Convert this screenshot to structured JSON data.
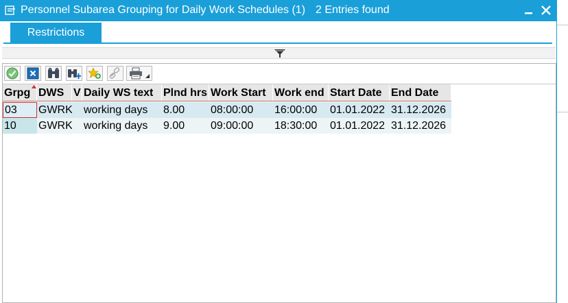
{
  "window": {
    "title": "Personnel Subarea Grouping for Daily Work Schedules (1)",
    "entries_found": "2 Entries found"
  },
  "tabs": [
    {
      "label": "Restrictions",
      "active": true
    }
  ],
  "toolbar": {
    "buttons": [
      {
        "name": "accept-button",
        "icon": "checkmark-icon"
      },
      {
        "name": "cancel-button",
        "icon": "close-x-icon"
      },
      {
        "name": "find-button",
        "icon": "binoculars-icon"
      },
      {
        "name": "find-next-button",
        "icon": "binoculars-plus-icon"
      },
      {
        "name": "add-favorite-button",
        "icon": "star-add-icon"
      },
      {
        "name": "link-button",
        "icon": "link-icon"
      },
      {
        "name": "print-button",
        "icon": "printer-icon"
      }
    ]
  },
  "table": {
    "columns": [
      "Grpg",
      "DWS",
      "V",
      "Daily WS text",
      "Plnd hrs",
      "Work Start",
      "Work end",
      "Start Date",
      "End Date"
    ],
    "rows": [
      [
        "03",
        "GWRK",
        "",
        "working days",
        "8.00",
        "08:00:00",
        "16:00:00",
        "01.01.2022",
        "31.12.2026"
      ],
      [
        "10",
        "GWRK",
        "",
        "working days",
        "9.00",
        "09:00:00",
        "18:30:00",
        "01.01.2022",
        "31.12.2026"
      ]
    ]
  },
  "colors": {
    "title_bar": "#1a9fd9",
    "row_selected": "#d7e9f1",
    "row_alt": "#ecf4f6",
    "header": "#e6e6e6"
  }
}
